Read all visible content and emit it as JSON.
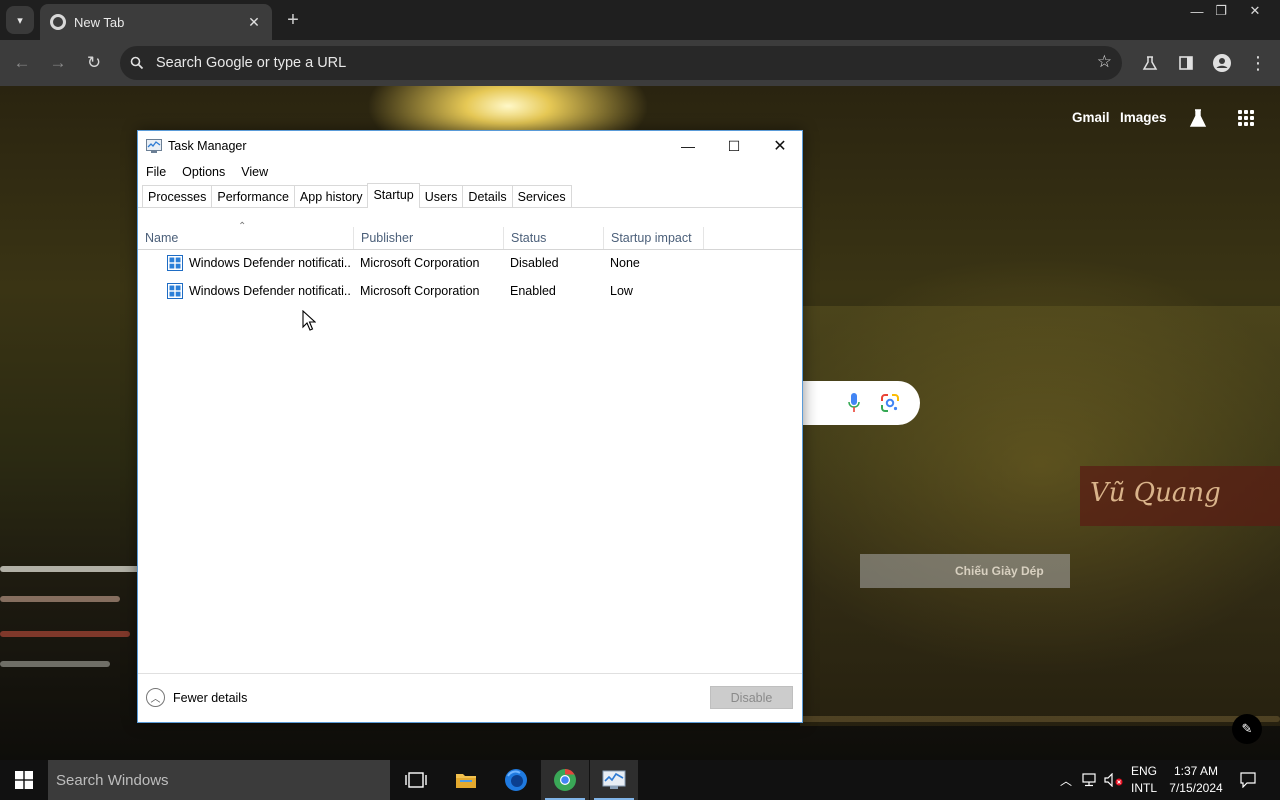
{
  "browser": {
    "tab_title": "New Tab",
    "omnibox_placeholder": "Search Google or type a URL"
  },
  "ntp": {
    "links": [
      "Gmail",
      "Images"
    ],
    "wall_sign": "Vũ Quang",
    "shop_sign": "Chiếu Giày Dép"
  },
  "task_manager": {
    "title": "Task Manager",
    "menu": [
      "File",
      "Options",
      "View"
    ],
    "tabs": [
      "Processes",
      "Performance",
      "App history",
      "Startup",
      "Users",
      "Details",
      "Services"
    ],
    "active_tab": "Startup",
    "columns": [
      "Name",
      "Publisher",
      "Status",
      "Startup impact"
    ],
    "rows": [
      {
        "name": "Windows Defender notificati...",
        "publisher": "Microsoft Corporation",
        "status": "Disabled",
        "impact": "None"
      },
      {
        "name": "Windows Defender notificati...",
        "publisher": "Microsoft Corporation",
        "status": "Enabled",
        "impact": "Low"
      }
    ],
    "fewer_details": "Fewer details",
    "disable_button": "Disable"
  },
  "taskbar": {
    "search_placeholder": "Search Windows",
    "lang_top": "ENG",
    "lang_bottom": "INTL",
    "time": "1:37 AM",
    "date": "7/15/2024"
  },
  "colors": {
    "chrome_dark": "#1f1f1f",
    "chrome_toolbar": "#3c3c3c",
    "tm_header_text": "#4c607a",
    "taskbar": "#111111",
    "accent": "#80b4e8"
  }
}
